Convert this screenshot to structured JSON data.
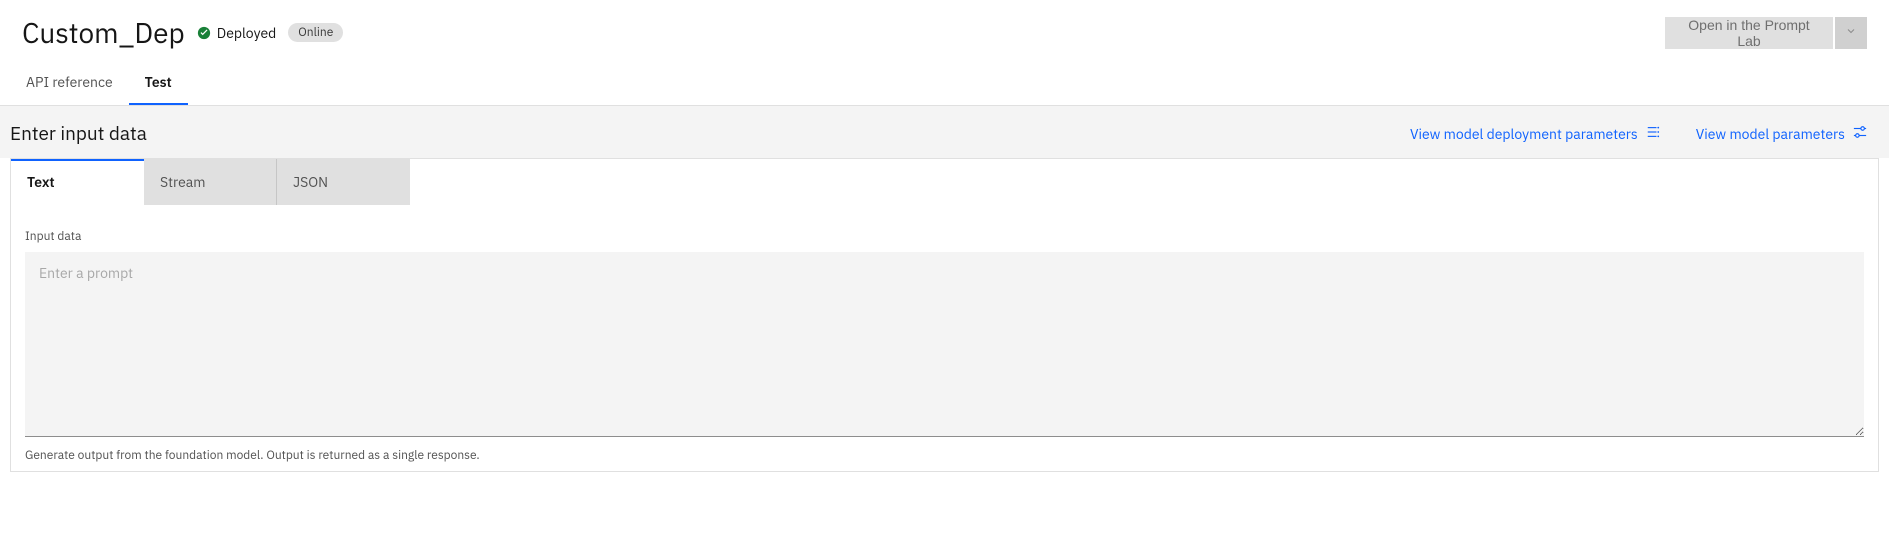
{
  "header": {
    "title": "Custom_Dep",
    "status_label": "Deployed",
    "online_badge": "Online",
    "prompt_lab_button": "Open in the Prompt Lab"
  },
  "nav_tabs": {
    "api_reference": "API reference",
    "test": "Test"
  },
  "sub_header": {
    "title": "Enter input data",
    "deployment_params_link": "View model deployment parameters",
    "model_params_link": "View model parameters"
  },
  "sub_tabs": {
    "text": "Text",
    "stream": "Stream",
    "json": "JSON"
  },
  "input": {
    "label": "Input data",
    "placeholder": "Enter a prompt",
    "helper": "Generate output from the foundation model. Output is returned as a single response."
  }
}
